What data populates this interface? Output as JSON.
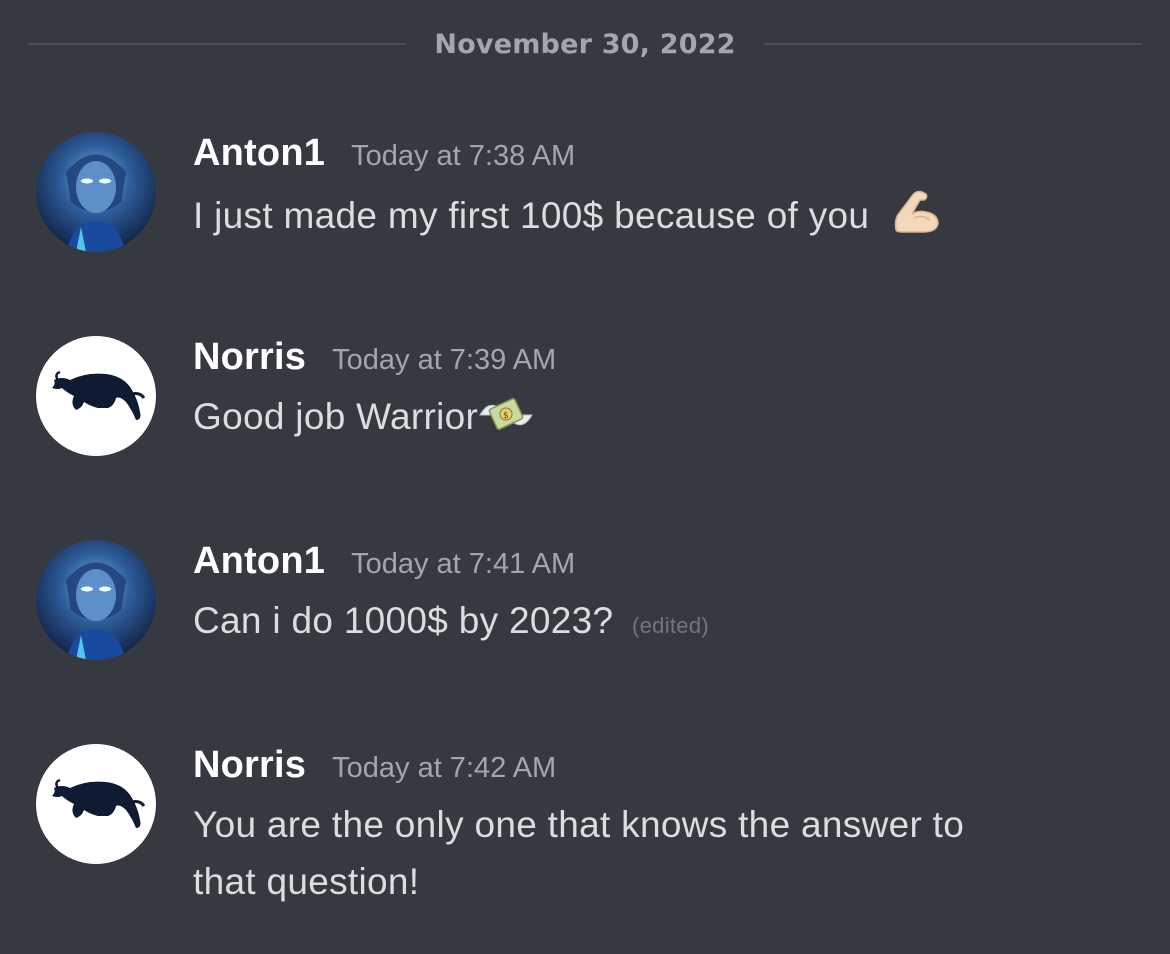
{
  "divider": {
    "date": "November 30, 2022"
  },
  "messages": [
    {
      "author": "Anton1",
      "timestamp": "Today at 7:38 AM",
      "text": "I just made my first 100$ because of you",
      "emoji": "flexed-biceps-icon",
      "avatar": "anton-avatar"
    },
    {
      "author": "Norris",
      "timestamp": "Today at 7:39 AM",
      "text": "Good job Warrior",
      "emoji": "money-with-wings-icon",
      "avatar": "norris-bull-avatar"
    },
    {
      "author": "Anton1",
      "timestamp": "Today at 7:41 AM",
      "text": "Can i do 1000$ by 2023?",
      "edited": "(edited)",
      "avatar": "anton-avatar"
    },
    {
      "author": "Norris",
      "timestamp": "Today at 7:42 AM",
      "text_line1": "You are the only one that knows the answer to",
      "text_line2": "that question!",
      "avatar": "norris-bull-avatar"
    }
  ],
  "colors": {
    "background": "#36393f",
    "username": "#ffffff",
    "message_text": "#dcddde",
    "timestamp": "#a3a6aa",
    "edited": "#72767d"
  }
}
